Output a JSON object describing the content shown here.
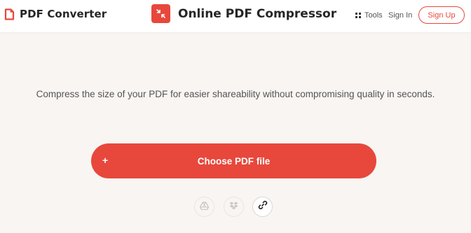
{
  "header": {
    "logo_text": "PDF Converter",
    "title": "Online PDF Compressor",
    "nav": {
      "tools_label": "Tools",
      "signin_label": "Sign In",
      "signup_label": "Sign Up"
    }
  },
  "main": {
    "tagline": "Compress the size of your PDF for easier shareability without compromising quality in seconds.",
    "choose_button": {
      "plus": "+",
      "label": "Choose PDF file"
    },
    "sources": [
      {
        "icon": "google-drive-icon",
        "enabled": false
      },
      {
        "icon": "dropbox-icon",
        "enabled": false
      },
      {
        "icon": "link-icon",
        "enabled": true
      }
    ]
  },
  "colors": {
    "accent": "#e7483b",
    "background": "#f8f5f3",
    "header_bg": "#ffffff",
    "text_dark": "#262626",
    "text_muted": "#555555"
  }
}
